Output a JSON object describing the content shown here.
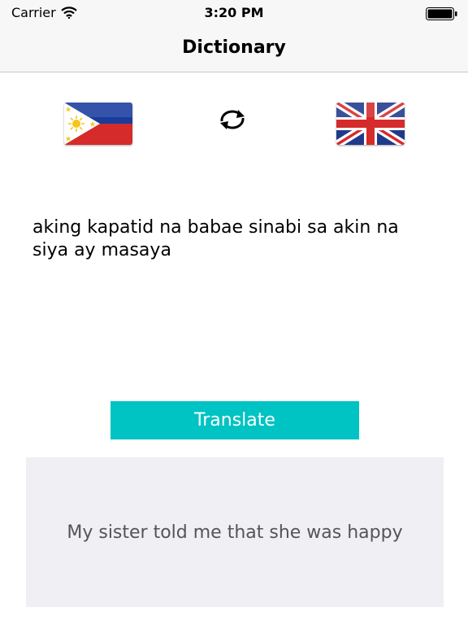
{
  "status_bar": {
    "carrier": "Carrier",
    "time": "3:20 PM",
    "icons": [
      "wifi-icon",
      "battery-icon"
    ]
  },
  "nav": {
    "title": "Dictionary"
  },
  "languages": {
    "source_flag": "philippines-flag-icon",
    "target_flag": "uk-flag-icon",
    "swap_icon": "swap-arrows-icon"
  },
  "source_text": "aking kapatid na babae sinabi sa akin na siya ay masaya",
  "translate_label": "Translate",
  "result_text": "My sister told me that she was happy",
  "colors": {
    "accent": "#00c3c3",
    "result_background": "#efeff4",
    "result_text": "#555555",
    "bar_background": "#f7f7f7"
  }
}
